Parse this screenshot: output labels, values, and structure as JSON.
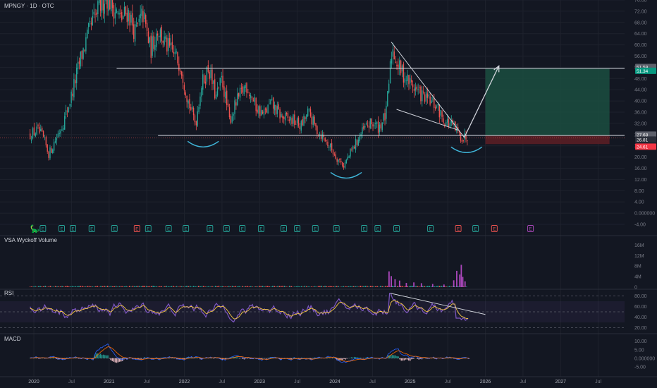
{
  "header": {
    "ticker": "MPNGY · 1D · OTC"
  },
  "panes": {
    "volume_title": "VSA Wyckoff Volume",
    "rsi_title": "RSI",
    "macd_title": "MACD"
  },
  "colors": {
    "background": "#131722",
    "grid": "#1e222d",
    "up": "#26a69a",
    "down": "#ef5350",
    "rsi": "#7e57c2",
    "rsi_ma": "#f5c842",
    "target_zone": "#1b4d40",
    "stop_zone": "#5a1e25",
    "arc": "#3fb6d9",
    "annotation": "#d1d4dc",
    "label_green": "#089981",
    "label_red": "#f23645",
    "label_grey": "#5d606b",
    "earnings_up": "#26a69a",
    "earnings_down": "#ef5350",
    "earnings_special": "#ab47bc"
  },
  "chart_data": [
    {
      "type": "candlestick",
      "title": "MPNGY · 1D · OTC",
      "ylim": [
        -4,
        76
      ],
      "yticks": [
        "76.00",
        "72.00",
        "68.00",
        "64.00",
        "60.00",
        "56.00",
        "52.00",
        "48.00",
        "44.00",
        "40.00",
        "36.00",
        "32.00",
        "28.00",
        "24.00",
        "20.00",
        "16.00",
        "12.00",
        "8.00",
        "4.00",
        "0.000000",
        "-4.00"
      ],
      "ytick_values": [
        76,
        72,
        68,
        64,
        60,
        56,
        52,
        48,
        44,
        40,
        36,
        32,
        28,
        24,
        20,
        16,
        12,
        8,
        4,
        0,
        -4
      ],
      "xticks": [
        "2020",
        "Jul",
        "2021",
        "Jul",
        "2022",
        "Jul",
        "2023",
        "Jul",
        "2024",
        "Jul",
        "2025",
        "Jul",
        "2026",
        "Jul",
        "2027",
        "Jul"
      ],
      "xtick_values": [
        2020.0,
        2020.5,
        2021.0,
        2021.5,
        2022.0,
        2022.5,
        2023.0,
        2023.5,
        2024.0,
        2024.5,
        2025.0,
        2025.5,
        2026.0,
        2026.5,
        2027.0,
        2027.5
      ],
      "price_path": [
        [
          2019.95,
          28.0
        ],
        [
          2020.05,
          29.5
        ],
        [
          2020.12,
          27.0
        ],
        [
          2020.2,
          21.0
        ],
        [
          2020.3,
          27.0
        ],
        [
          2020.4,
          33.0
        ],
        [
          2020.5,
          42.0
        ],
        [
          2020.62,
          55.0
        ],
        [
          2020.75,
          66.0
        ],
        [
          2020.85,
          72.0
        ],
        [
          2020.95,
          78.0
        ],
        [
          2021.05,
          74.0
        ],
        [
          2021.15,
          69.0
        ],
        [
          2021.25,
          72.0
        ],
        [
          2021.35,
          64.0
        ],
        [
          2021.45,
          71.0
        ],
        [
          2021.55,
          58.0
        ],
        [
          2021.65,
          66.0
        ],
        [
          2021.75,
          60.0
        ],
        [
          2021.85,
          57.0
        ],
        [
          2021.95,
          53.0
        ],
        [
          2022.05,
          40.0
        ],
        [
          2022.15,
          32.0
        ],
        [
          2022.22,
          45.0
        ],
        [
          2022.32,
          52.0
        ],
        [
          2022.42,
          41.0
        ],
        [
          2022.5,
          48.0
        ],
        [
          2022.6,
          33.0
        ],
        [
          2022.7,
          40.0
        ],
        [
          2022.82,
          46.0
        ],
        [
          2022.95,
          38.0
        ],
        [
          2023.05,
          35.0
        ],
        [
          2023.15,
          39.0
        ],
        [
          2023.3,
          34.0
        ],
        [
          2023.45,
          33.0
        ],
        [
          2023.55,
          31.0
        ],
        [
          2023.65,
          36.0
        ],
        [
          2023.75,
          30.0
        ],
        [
          2023.85,
          27.0
        ],
        [
          2023.95,
          23.0
        ],
        [
          2024.05,
          19.0
        ],
        [
          2024.12,
          17.0
        ],
        [
          2024.22,
          22.0
        ],
        [
          2024.32,
          27.0
        ],
        [
          2024.42,
          31.0
        ],
        [
          2024.5,
          32.0
        ],
        [
          2024.58,
          30.5
        ],
        [
          2024.68,
          35.0
        ],
        [
          2024.76,
          59.0
        ],
        [
          2024.85,
          52.0
        ],
        [
          2024.95,
          48.0
        ],
        [
          2025.05,
          45.0
        ],
        [
          2025.15,
          42.0
        ],
        [
          2025.25,
          40.0
        ],
        [
          2025.35,
          38.0
        ],
        [
          2025.45,
          33.0
        ],
        [
          2025.55,
          31.5
        ],
        [
          2025.62,
          29.0
        ],
        [
          2025.7,
          26.8
        ],
        [
          2025.76,
          27.5
        ]
      ],
      "annotations": {
        "resistance_level": 51.59,
        "neckline_level": 27.68,
        "last_price": 26.81,
        "target_label": "51.59",
        "target_sub_label": "51.34",
        "entry_label": "27.68",
        "current_label": "26.81",
        "stop_label": "24.61",
        "stop_level": 24.61,
        "projection_end": [
          2025.72,
          27.0
        ],
        "projection_target": [
          2026.18,
          52.5
        ],
        "wedge_upper": [
          [
            2024.75,
            61.0
          ],
          [
            2025.72,
            27.0
          ]
        ],
        "wedge_lower": [
          [
            2024.82,
            37.0
          ],
          [
            2025.65,
            29.5
          ]
        ],
        "resistance_line_from": 2021.1,
        "neckline_from": 2021.65,
        "position_box_from": 2026.0,
        "position_box_to": 2027.65,
        "arcs": [
          {
            "center": [
              2022.25,
              25.6
            ],
            "level": "shoulder-left"
          },
          {
            "center": [
              2024.15,
              14.5
            ],
            "level": "head"
          },
          {
            "center": [
              2025.75,
              23.6
            ],
            "level": "shoulder-right"
          }
        ]
      },
      "earnings_markers": [
        {
          "x": 2020.0,
          "kind": "E",
          "tone": "up"
        },
        {
          "x": 2020.25,
          "kind": "E",
          "tone": "up"
        },
        {
          "x": 2020.4,
          "kind": "E",
          "tone": "up"
        },
        {
          "x": 2020.65,
          "kind": "E",
          "tone": "up"
        },
        {
          "x": 2020.95,
          "kind": "E",
          "tone": "up"
        },
        {
          "x": 2021.25,
          "kind": "E",
          "tone": "down"
        },
        {
          "x": 2021.4,
          "kind": "E",
          "tone": "up"
        },
        {
          "x": 2021.67,
          "kind": "E",
          "tone": "up"
        },
        {
          "x": 2021.9,
          "kind": "E",
          "tone": "up"
        },
        {
          "x": 2022.22,
          "kind": "E",
          "tone": "up"
        },
        {
          "x": 2022.44,
          "kind": "E",
          "tone": "up"
        },
        {
          "x": 2022.65,
          "kind": "E",
          "tone": "up"
        },
        {
          "x": 2022.9,
          "kind": "E",
          "tone": "up"
        },
        {
          "x": 2023.2,
          "kind": "E",
          "tone": "up"
        },
        {
          "x": 2023.38,
          "kind": "E",
          "tone": "up"
        },
        {
          "x": 2023.62,
          "kind": "E",
          "tone": "up"
        },
        {
          "x": 2023.9,
          "kind": "E",
          "tone": "up"
        },
        {
          "x": 2024.27,
          "kind": "E",
          "tone": "up"
        },
        {
          "x": 2024.45,
          "kind": "E",
          "tone": "up"
        },
        {
          "x": 2024.7,
          "kind": "E",
          "tone": "up"
        },
        {
          "x": 2025.15,
          "kind": "E",
          "tone": "up"
        },
        {
          "x": 2025.52,
          "kind": "E",
          "tone": "down"
        },
        {
          "x": 2025.75,
          "kind": "E",
          "tone": "up"
        },
        {
          "x": 2026.0,
          "kind": "E",
          "tone": "down"
        },
        {
          "x": 2026.48,
          "kind": "E",
          "tone": "special"
        }
      ]
    },
    {
      "type": "bar",
      "title": "VSA Wyckoff Volume",
      "ylim": [
        0,
        18
      ],
      "yticks": [
        "16M",
        "12M",
        "8M",
        "4M",
        "0"
      ],
      "ytick_values": [
        16,
        12,
        8,
        4,
        0
      ],
      "spikes": [
        [
          2024.72,
          6.0
        ],
        [
          2024.75,
          4.2
        ],
        [
          2024.8,
          3.0
        ],
        [
          2024.86,
          2.5
        ],
        [
          2024.95,
          1.6
        ],
        [
          2025.05,
          1.8
        ],
        [
          2025.15,
          1.5
        ],
        [
          2025.3,
          1.2
        ],
        [
          2025.45,
          1.0
        ],
        [
          2025.58,
          2.6
        ],
        [
          2025.62,
          6.2
        ],
        [
          2025.66,
          4.8
        ],
        [
          2025.68,
          8.5
        ],
        [
          2025.7,
          3.9
        ],
        [
          2025.73,
          2.2
        ]
      ]
    },
    {
      "type": "line",
      "title": "RSI",
      "ylim": [
        10,
        90
      ],
      "yticks": [
        "80.00",
        "60.00",
        "40.00",
        "20.00"
      ],
      "ytick_values": [
        80,
        60,
        40,
        20
      ],
      "band": [
        30,
        70
      ],
      "trendline": [
        [
          2024.74,
          85.0
        ],
        [
          2026.0,
          45.0
        ]
      ]
    },
    {
      "type": "line",
      "title": "MACD",
      "ylim": [
        -10,
        14
      ],
      "yticks": [
        "10.00",
        "5.00",
        "0.000000",
        "-5.00"
      ],
      "ytick_values": [
        10,
        5,
        0,
        -5
      ]
    }
  ]
}
